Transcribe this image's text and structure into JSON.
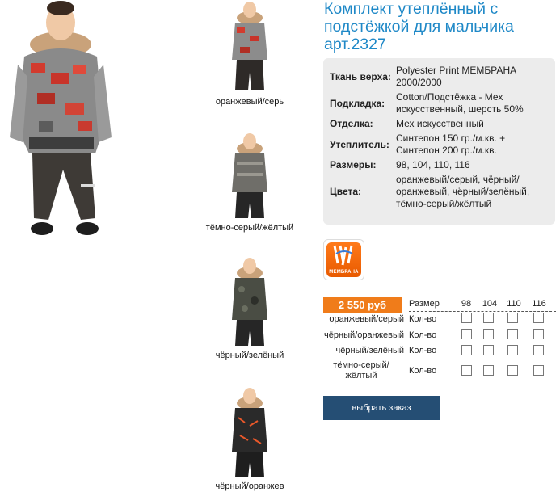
{
  "product": {
    "title": "Комплект утеплённый с подстёжкой для мальчика арт.2327"
  },
  "specs": [
    {
      "label": "Ткань верха:",
      "value": "Polyester Print МЕМБРАНА 2000/2000"
    },
    {
      "label": "Подкладка:",
      "value": "Cotton/Подстёжка - Мех искусственный, шерсть 50%"
    },
    {
      "label": "Отделка:",
      "value": "Мех искусственный"
    },
    {
      "label": "Утеплитель:",
      "value": "Синтепон 150 гр./м.кв. + Синтепон 200 гр./м.кв."
    },
    {
      "label": "Размеры:",
      "value": "98, 104, 110, 116"
    },
    {
      "label": "Цвета:",
      "value": "оранжевый/серый, чёрный/оранжевый, чёрный/зелёный, тёмно-серый/жёлтый"
    }
  ],
  "badge": {
    "label": "МЕМБРАНА"
  },
  "thumbnails": [
    {
      "caption": "оранжевый/серь"
    },
    {
      "caption": "тёмно-серый/жёлтый"
    },
    {
      "caption": "чёрный/зелёный"
    },
    {
      "caption": "чёрный/оранжев"
    }
  ],
  "order": {
    "price": "2 550 руб",
    "size_label": "Размер",
    "sizes": [
      "98",
      "104",
      "110",
      "116"
    ],
    "qty_label": "Кол-во",
    "rows": [
      {
        "color": "оранжевый/серый"
      },
      {
        "color": "чёрный/оранжевый"
      },
      {
        "color": "чёрный/зелёный"
      },
      {
        "color": "тёмно-серый/жёлтый"
      }
    ],
    "button": "выбрать заказ"
  },
  "colors": {
    "title": "#1e88c7",
    "price_bg": "#f07c1a",
    "button_bg": "#254e74",
    "spec_bg": "#ececec"
  }
}
